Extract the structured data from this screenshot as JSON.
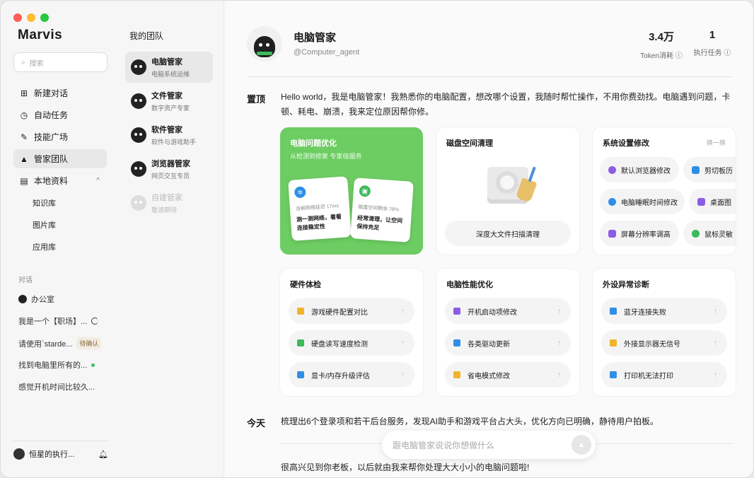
{
  "app": {
    "name": "Marvis"
  },
  "sidebar": {
    "search_placeholder": "搜索",
    "nav": [
      {
        "label": "新建对话",
        "icon": "plus-square-icon"
      },
      {
        "label": "自动任务",
        "icon": "clock-icon"
      },
      {
        "label": "技能广场",
        "icon": "wrench-icon"
      },
      {
        "label": "管家团队",
        "icon": "graduation-cap-icon"
      },
      {
        "label": "本地资料",
        "icon": "document-icon"
      }
    ],
    "local_sub": [
      "知识库",
      "图片库",
      "应用库"
    ],
    "conv_section": "对话",
    "office": "办公室",
    "conversations": [
      {
        "text": "我是一个【职场】..."
      },
      {
        "text": "请使用`starde...",
        "badge": "待确认"
      },
      {
        "text": "找到电脑里所有的..."
      },
      {
        "text": "感觉开机时间比较久..."
      }
    ],
    "user": "恒星的执行..."
  },
  "team": {
    "title": "我的团队",
    "agents": [
      {
        "name": "电脑管家",
        "desc": "电脑系统运维"
      },
      {
        "name": "文件管家",
        "desc": "数字资产专家"
      },
      {
        "name": "软件管家",
        "desc": "软件与游戏助手"
      },
      {
        "name": "浏览器管家",
        "desc": "网页交互专员"
      },
      {
        "name": "自建管家",
        "desc": "敬请期待"
      }
    ]
  },
  "profile": {
    "name": "电脑管家",
    "handle": "@Computer_agent",
    "tokens_value": "3.4万",
    "tokens_label": "Token消耗",
    "tasks_value": "1",
    "tasks_label": "执行任务"
  },
  "pinned": {
    "label": "置顶",
    "text": "Hello world，我是电脑管家！我熟悉你的电脑配置，想改哪个设置，我随时帮忙操作，不用你费劲找。电脑遇到问题，卡顿、耗电、崩溃，我来定位原因帮你修。"
  },
  "cards": {
    "opt": {
      "title": "电脑问题优化",
      "sub": "从检测到修复 专家级服务",
      "m1_label": "当前网络延迟 17ms",
      "m1_text": "测一测网络，看看连接稳定性",
      "m2_label": "磁盘空间剩余 78%",
      "m2_text": "经常清理，让空间保持充足"
    },
    "disk": {
      "title": "磁盘空间清理",
      "button": "深度大文件扫描清理"
    },
    "settings": {
      "title": "系统设置修改",
      "swap": "换一换",
      "chips": [
        "默认浏览器修改",
        "剪切板历",
        "电脑睡眠时间修改",
        "桌面图",
        "屏幕分辨率调高",
        "鼠标灵敏"
      ]
    },
    "hardware": {
      "title": "硬件体检",
      "rows": [
        "游戏硬件配置对比",
        "硬盘读写速度检测",
        "显卡/内存升级评估"
      ]
    },
    "perf": {
      "title": "电脑性能优化",
      "rows": [
        "开机启动项修改",
        "各类驱动更新",
        "省电模式修改"
      ]
    },
    "peripheral": {
      "title": "外设异常诊断",
      "rows": [
        "蓝牙连接失败",
        "外接显示器无信号",
        "打印机无法打印"
      ]
    }
  },
  "today": {
    "label": "今天",
    "text": "梳理出6个登录项和若干后台服务，发现AI助手和游戏平台占大头，优化方向已明确，静待用户拍板。"
  },
  "footer_text": "很高兴见到你老板，以后就由我来帮你处理大大小小的电脑问题啦!",
  "input": {
    "placeholder": "跟电脑管家说说你想做什么"
  },
  "colors": {
    "accent": "#6dcc62",
    "traffic": [
      "#ff5f57",
      "#febc2e",
      "#28c840"
    ]
  }
}
